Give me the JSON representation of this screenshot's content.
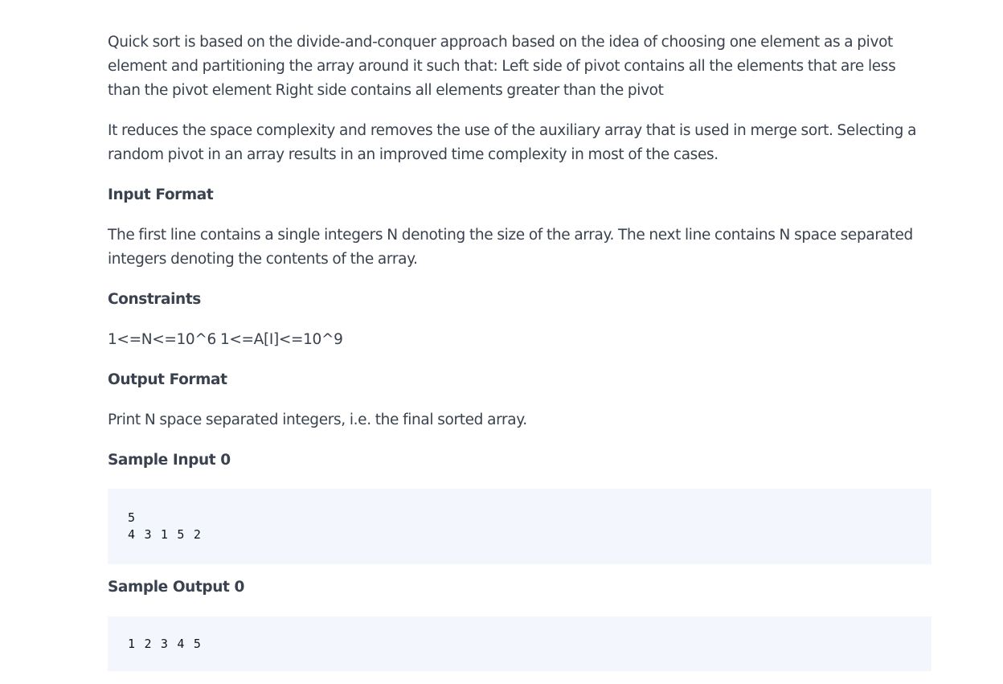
{
  "problem": {
    "description_p1": "Quick sort is based on the divide-and-conquer approach based on the idea of choosing one element as a pivot element and partitioning the array around it such that: Left side of pivot contains all the elements that are less than the pivot element Right side contains all elements greater than the pivot",
    "description_p2": "It reduces the space complexity and removes the use of the auxiliary array that is used in merge sort. Selecting a random pivot in an array results in an improved time complexity in most of the cases.",
    "input_format_heading": "Input Format",
    "input_format_text": "The first line contains a single integers N denoting the size of the array. The next line contains N space separated integers denoting the contents of the array.",
    "constraints_heading": "Constraints",
    "constraints_text": "1<=N<=10^6 1<=A[I]<=10^9",
    "output_format_heading": "Output Format",
    "output_format_text": "Print N space separated integers, i.e. the final sorted array.",
    "sample_input_heading": "Sample Input 0",
    "sample_input_code": "5\n4 3 1 5 2",
    "sample_output_heading": "Sample Output 0",
    "sample_output_code": "1 2 3 4 5"
  }
}
